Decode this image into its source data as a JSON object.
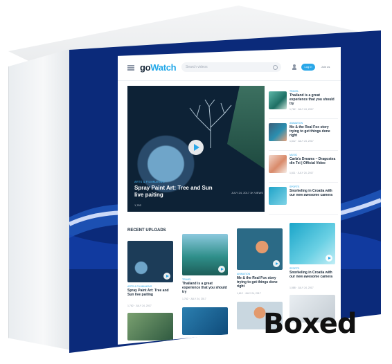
{
  "colors": {
    "accent": "#21a7e8",
    "box_front": "#0b2a7a"
  },
  "header": {
    "logo_prefix": "go",
    "logo_suffix": "Watch",
    "search_placeholder": "Search videos",
    "login_label": "Log in",
    "join_label": "Join us"
  },
  "hero": {
    "category": "ARTS & FILMMAKING",
    "title": "Spray Paint Art: Tree and Sun live paiting",
    "meta": "1,762",
    "date": "JULY 24, 2017",
    "views": "1K VIEWS"
  },
  "sidebar": {
    "items": [
      {
        "category": "TRAVEL",
        "title": "Thailand is a great experience that you should try",
        "meta": "1,762 · JULY 24, 2017"
      },
      {
        "category": "ANIMATION",
        "title": "Me & the Real Fox story trying to get things done right",
        "meta": "1,612 · JULY 24, 2017"
      },
      {
        "category": "MUSIC",
        "title": "Carla's Dreams – Dragostea din Tei | Official Video",
        "meta": "1,611 · JULY 24, 2017"
      },
      {
        "category": "SPORTS",
        "title": "Snorkeling in Croatia with our new awesome camera",
        "meta": ""
      }
    ]
  },
  "uploads": {
    "section_title": "RECENT UPLOADS",
    "cards": [
      {
        "category": "ARTS & FILMMAKING",
        "title": "Spray Paint Art: Tree and Sun live paiting",
        "meta": "1,762 · JULY 24, 2017"
      },
      {
        "category": "TRAVEL",
        "title": "Thailand is a great experience that you should try",
        "meta": "1,762 · JULY 24, 2017"
      },
      {
        "category": "ANIMATION",
        "title": "Me & the Real Fox story trying to get things done right",
        "meta": "1,612 · JULY 24, 2017"
      },
      {
        "category": "SPORTS",
        "title": "Snorkeling in Croatia with our new awesome camera",
        "meta": "1,588 · JULY 24, 2017"
      }
    ]
  },
  "overlay": {
    "boxed": "Boxed"
  }
}
